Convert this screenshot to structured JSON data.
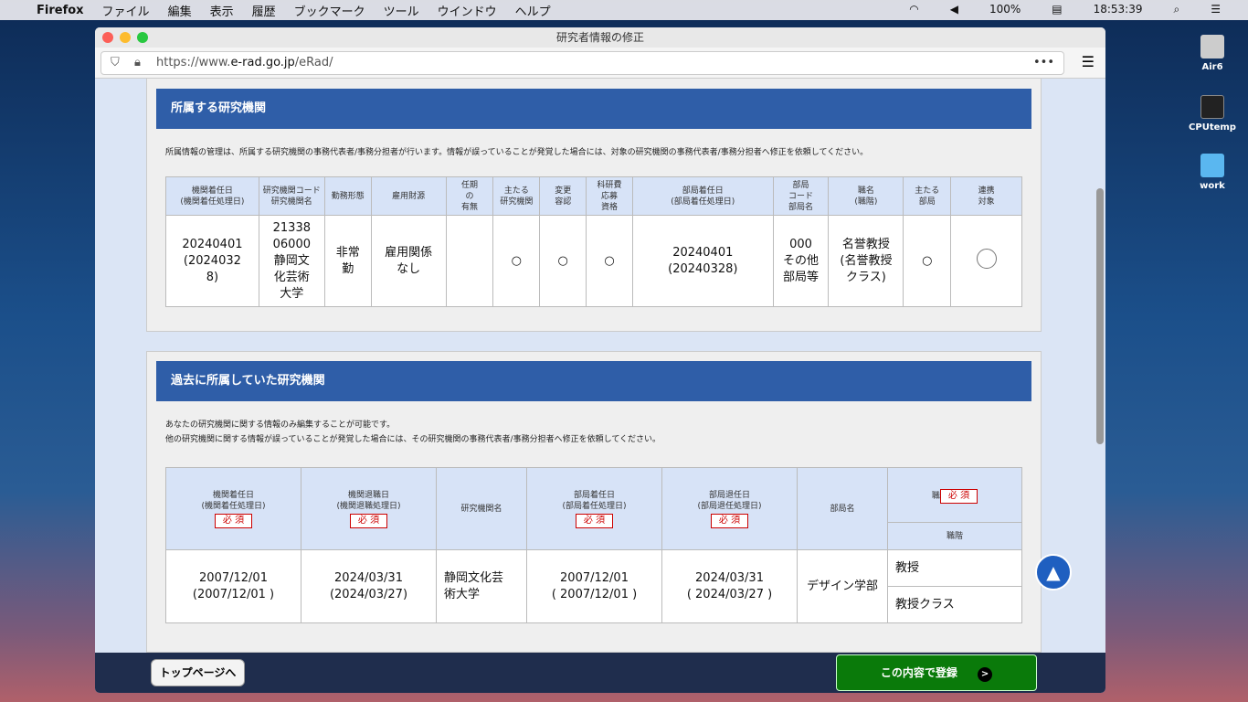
{
  "menubar": {
    "app": "Firefox",
    "items": [
      "ファイル",
      "編集",
      "表示",
      "履歴",
      "ブックマーク",
      "ツール",
      "ウインドウ",
      "ヘルプ"
    ],
    "battery": "100%",
    "time": "18:53:39"
  },
  "desktop": [
    {
      "label": "Air6"
    },
    {
      "label": "CPUtemp"
    },
    {
      "label": "work"
    }
  ],
  "window": {
    "title": "研究者情報の修正",
    "url_prefix": "https://www.",
    "url_domain": "e-rad.go.jp",
    "url_path": "/eRad/"
  },
  "current": {
    "title": "所属する研究機関",
    "note": "所属情報の管理は、所属する研究機関の事務代表者/事務分担者が行います。情報が誤っていることが発覚した場合には、対象の研究機関の事務代表者/事務分担者へ修正を依頼してください。",
    "headers": [
      "機関着任日\n(機関着任処理日)",
      "研究機関コード\n研究機関名",
      "勤務形態",
      "雇用財源",
      "任期\nの\n有無",
      "主たる\n研究機関",
      "変更\n容認",
      "科研費\n応募\n資格",
      "部局着任日\n(部局着任処理日)",
      "部局\nコード\n部局名",
      "職名\n(職階)",
      "主たる\n部局",
      "連携\n対象"
    ],
    "row": [
      "20240401\n(2024032\n8)",
      "21338\n06000\n静岡文\n化芸術\n大学",
      "非常\n勤",
      "雇用関係\nなし",
      "",
      "○",
      "○",
      "○",
      "20240401\n(20240328)",
      "000\nその他\n部局等",
      "名誉教授\n(名誉教授\nクラス)",
      "○",
      ""
    ]
  },
  "past": {
    "title": "過去に所属していた研究機関",
    "note1": "あなたの研究機関に関する情報のみ編集することが可能です。",
    "note2": "他の研究機関に関する情報が誤っていることが発覚した場合には、その研究機関の事務代表者/事務分担者へ修正を依頼してください。",
    "headers": [
      "機関着任日\n(機関着任処理日)",
      "機関退職日\n(機関退職処理日)",
      "研究機関名",
      "部局着任日\n(部局着任処理日)",
      "部局退任日\n(部局退任処理日)",
      "部局名",
      "職",
      "職階"
    ],
    "required": "必 須",
    "row": [
      "2007/12/01\n(2007/12/01 )",
      "2024/03/31\n(2024/03/27)",
      "静岡文化芸\n術大学",
      "2007/12/01\n( 2007/12/01 )",
      "2024/03/31\n( 2024/03/27 )",
      "デザイン学部",
      "教授",
      "教授クラス"
    ]
  },
  "footer": {
    "top_button": "トップページへ",
    "register_button": "この内容で登録"
  }
}
